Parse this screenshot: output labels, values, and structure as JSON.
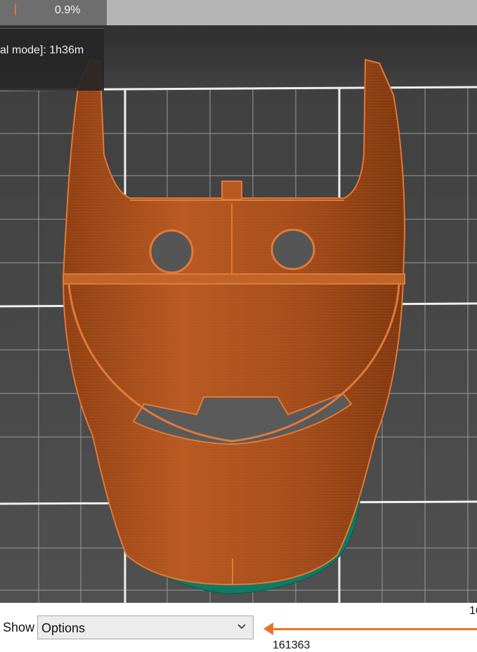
{
  "top_bar": {
    "progress_percent": "0.9%"
  },
  "info_panel": {
    "print_time_text": "al mode]:  1h36m"
  },
  "colors": {
    "model_orange": "#b85a22",
    "model_outline": "#e07a3a",
    "support_green": "#0f7a66",
    "grid_line": "#f0f0f0",
    "accent": "#e8742a"
  },
  "bottom_bar": {
    "show_label": "Show",
    "options_value": "Options",
    "slider_top_value": "16",
    "slider_bottom_value": "161363"
  }
}
